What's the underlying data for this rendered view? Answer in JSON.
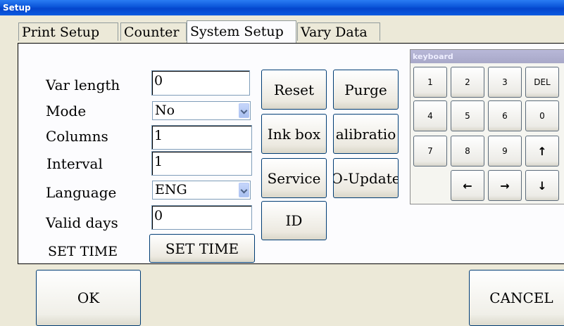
{
  "window": {
    "title": "Setup"
  },
  "tabs": [
    "Print Setup",
    "Counter",
    "System Setup",
    "Vary Data"
  ],
  "form": {
    "var_length": {
      "label": "Var length",
      "value": "0"
    },
    "mode": {
      "label": "Mode",
      "value": "No"
    },
    "columns": {
      "label": "Columns",
      "value": "1"
    },
    "interval": {
      "label": "Interval",
      "value": "1"
    },
    "language": {
      "label": "Language",
      "value": "ENG"
    },
    "valid_days": {
      "label": "Valid days",
      "value": "0"
    },
    "set_time": {
      "label": "SET TIME",
      "button": "SET TIME"
    }
  },
  "actions": {
    "reset": "Reset",
    "purge": "Purge",
    "ink_box": "Ink box",
    "calibration": "alibratio",
    "service": "Service",
    "update": "O-Update",
    "id": "ID"
  },
  "keyboard": {
    "title": "keyboard",
    "keys": [
      "1",
      "2",
      "3",
      "DEL",
      "4",
      "5",
      "6",
      "0",
      "7",
      "8",
      "9",
      "↑",
      "←",
      "→",
      "↓"
    ]
  },
  "footer": {
    "ok": "OK",
    "cancel": "CANCEL"
  }
}
